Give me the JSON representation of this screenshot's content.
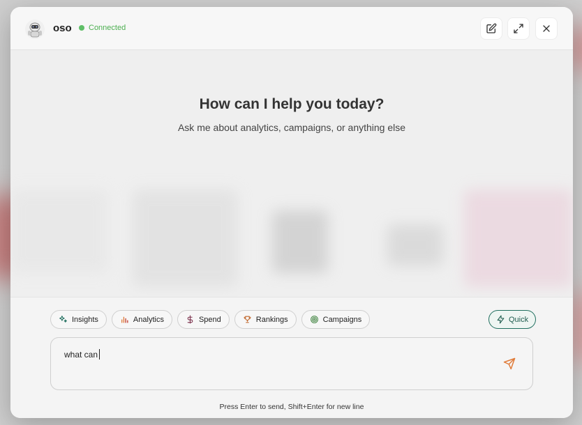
{
  "header": {
    "app_name": "oso",
    "status": "Connected"
  },
  "main": {
    "greeting": "How can I help you today?",
    "subtitle": "Ask me about analytics, campaigns, or anything else"
  },
  "chips": [
    {
      "label": "Insights",
      "icon": "sparkles-icon"
    },
    {
      "label": "Analytics",
      "icon": "bar-chart-icon"
    },
    {
      "label": "Spend",
      "icon": "dollar-icon"
    },
    {
      "label": "Rankings",
      "icon": "trophy-icon"
    },
    {
      "label": "Campaigns",
      "icon": "target-icon"
    }
  ],
  "mode": {
    "label": "Quick",
    "icon": "lightning-icon"
  },
  "composer": {
    "value": "what can",
    "hint": "Press Enter to send, Shift+Enter for new line"
  },
  "colors": {
    "connected": "#5fbf68",
    "quick_accent": "#1f6e5e",
    "send": "#e07b39"
  }
}
